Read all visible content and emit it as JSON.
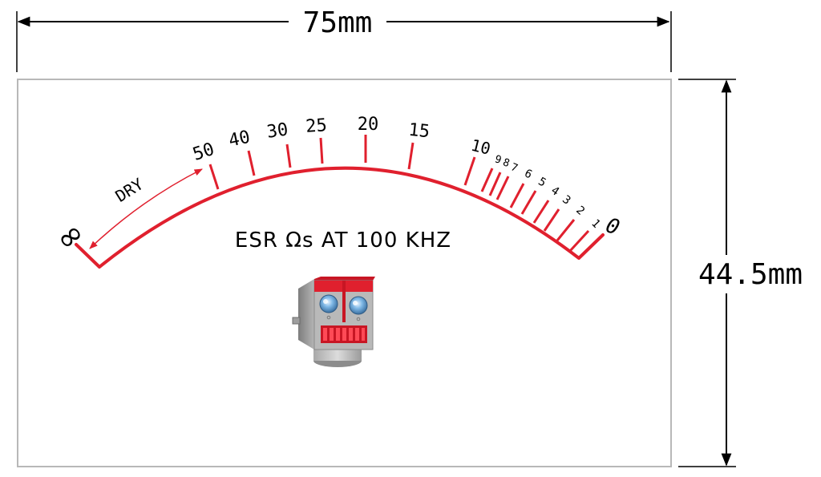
{
  "dimensions": {
    "width_label": "75mm",
    "height_label": "44.5mm"
  },
  "meter": {
    "title": "ESR Ωs AT 100 KHZ",
    "infinity_symbol": "∞",
    "zero_symbol": "0",
    "dry_label": "DRY",
    "scale_labels": [
      "50",
      "40",
      "30",
      "25",
      "20",
      "15",
      "10",
      "9",
      "8",
      "7",
      "6",
      "5",
      "4",
      "3",
      "2",
      "1"
    ]
  },
  "colors": {
    "scale_red": "#e0202e",
    "outline_gray": "#b8b8b8",
    "text_black": "#000000"
  },
  "icons": {
    "mascot": "robot-head-icon"
  }
}
